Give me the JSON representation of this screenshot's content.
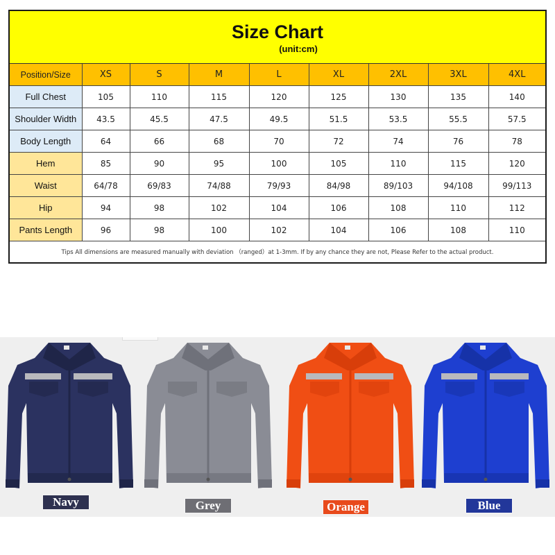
{
  "size_chart": {
    "title": "Size Chart",
    "unit": "(unit:cm)",
    "header_label": "Position/Size",
    "sizes": [
      "XS",
      "S",
      "M",
      "L",
      "XL",
      "2XL",
      "3XL",
      "4XL"
    ],
    "rows": [
      {
        "label": "Full Chest",
        "group": "top",
        "values": [
          "105",
          "110",
          "115",
          "120",
          "125",
          "130",
          "135",
          "140"
        ]
      },
      {
        "label": "Shoulder Width",
        "group": "top",
        "values": [
          "43.5",
          "45.5",
          "47.5",
          "49.5",
          "51.5",
          "53.5",
          "55.5",
          "57.5"
        ]
      },
      {
        "label": "Body Length",
        "group": "top",
        "values": [
          "64",
          "66",
          "68",
          "70",
          "72",
          "74",
          "76",
          "78"
        ]
      },
      {
        "label": "Hem",
        "group": "bottom",
        "values": [
          "85",
          "90",
          "95",
          "100",
          "105",
          "110",
          "115",
          "120"
        ]
      },
      {
        "label": "Waist",
        "group": "bottom",
        "values": [
          "64/78",
          "69/83",
          "74/88",
          "79/93",
          "84/98",
          "89/103",
          "94/108",
          "99/113"
        ]
      },
      {
        "label": "Hip",
        "group": "bottom",
        "values": [
          "94",
          "98",
          "102",
          "104",
          "106",
          "108",
          "110",
          "112"
        ]
      },
      {
        "label": "Pants Length",
        "group": "bottom",
        "values": [
          "96",
          "98",
          "100",
          "102",
          "104",
          "106",
          "108",
          "110"
        ]
      }
    ],
    "tips": "Tips All dimensions are measured manually with deviation （ranged）at 1-3mm. If by any chance they are not, Please Refer to the actual product."
  },
  "colors": {
    "title_band": "#ffff00",
    "header_row": "#ffc000",
    "top_label_bg": "#ddebf7",
    "bottom_label_bg": "#ffe699"
  },
  "variants": [
    {
      "name": "Navy",
      "fabric": "#2b3260",
      "shade": "#1f2548",
      "label_bg": "#2e3150",
      "reflective": true
    },
    {
      "name": "Grey",
      "fabric": "#8a8c95",
      "shade": "#6f717a",
      "label_bg": "#6e6e74",
      "reflective": false
    },
    {
      "name": "Orange",
      "fabric": "#f04e14",
      "shade": "#d83e0a",
      "label_bg": "#e84a1c",
      "reflective": true
    },
    {
      "name": "Blue",
      "fabric": "#1e3fd0",
      "shade": "#1632a8",
      "label_bg": "#22379a",
      "reflective": true
    }
  ]
}
